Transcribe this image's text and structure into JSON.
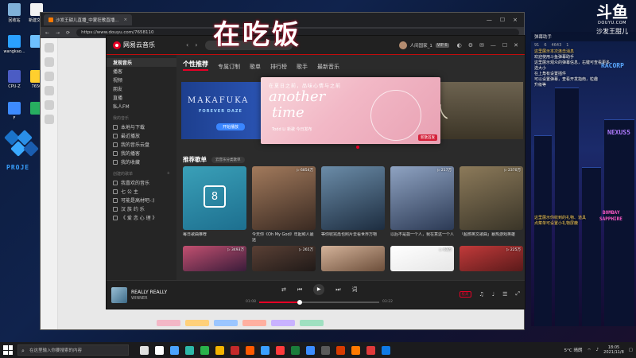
{
  "desktop": {
    "icons": [
      {
        "label": "回收站",
        "color": "#7fb1d9"
      },
      {
        "label": "新建文本",
        "color": "#f2f2f2"
      },
      {
        "label": "wangkao...",
        "color": "#2aa0ff"
      },
      {
        "label": "",
        "color": "#6ec0ff"
      },
      {
        "label": "CPU-Z",
        "color": "#4b5cc4"
      },
      {
        "label": "7656",
        "color": "#ffcf2e"
      },
      {
        "label": "F",
        "color": "#3d8bff"
      },
      {
        "label": "",
        "color": "#27ae60"
      }
    ],
    "deco_text": "PROJE"
  },
  "douyu": {
    "logo": "斗鱼",
    "url": "DOUYU.COM",
    "streamer": "沙发王甜儿"
  },
  "overlay": {
    "title": "在吃饭"
  },
  "browser": {
    "tab_title": "沙发王甜儿直播_中蒙狂歌直播...",
    "address": "https://www.douyu.com/7658110",
    "close": "×",
    "min": "—",
    "max": "☐",
    "back": "←",
    "fwd": "→",
    "refresh": "⟳"
  },
  "chat": {
    "header": "弹幕助手",
    "stats": [
      "91",
      "6",
      "4643",
      "1"
    ],
    "messages": [
      {
        "text": "这里展示本次连击消息",
        "sys": true
      },
      {
        "text": "欢迎使用斗鱼弹幕助手",
        "sys": false
      },
      {
        "text": "这里展示观众的弹幕信息，右键可查看更多",
        "sys": false
      },
      {
        "text": "选大小",
        "sys": false
      },
      {
        "text": "在上角有设置插件",
        "sys": false
      },
      {
        "text": "可以设置弹幕，查看开发指南，粒趣",
        "sys": false
      },
      {
        "text": "升级等",
        "sys": false
      },
      {
        "text": "这里展示你收到的礼物、道具",
        "sys": true
      },
      {
        "text": "点菜单可设置小礼物屏蔽",
        "sys": true
      }
    ],
    "neon": [
      "RACORP",
      "NEXUS5",
      "BOMBAY",
      "SAPPHIRE"
    ]
  },
  "ncm": {
    "app_name": "网易云音乐",
    "search_placeholder": "",
    "user_name": "人间国家_1",
    "vip": "VIP 6",
    "sidebar": {
      "items_top": [
        "发现音乐",
        "播客",
        "视频",
        "朋友",
        "直播",
        "私人FM"
      ],
      "section_mine": "我的音乐",
      "items_mine": [
        "本地与下载",
        "最近播放",
        "我的音乐云盘",
        "我的播客",
        "我的收藏"
      ],
      "section_created": "创建的歌单",
      "items_created": [
        "我喜欢的音乐",
        "七 公 主",
        "可能是高材吧-:)",
        "汉 族 约 乐",
        "《 爱 恋 心 理 》"
      ]
    },
    "tabs": [
      "个性推荐",
      "专属订制",
      "歌单",
      "排行榜",
      "歌手",
      "最新音乐"
    ],
    "banner": {
      "left_title": "MAKAFUKA",
      "left_sub": "FOREVER DAZE",
      "left_btn": "开始播放",
      "center_zh": "在夏日之前，品味心情与之前",
      "center_en1": "another",
      "center_en2": "time",
      "center_artist": "Todd Li 新歌 今日发布",
      "center_tag": "新歌首发",
      "right_char": "人"
    },
    "recommend": {
      "title": "推荐歌单",
      "pill": "云音乐分类歌单",
      "cards": [
        {
          "title": "每日歌曲推荐",
          "plays": "",
          "c1": "#1d6f8f",
          "c2": "#3aa0b8",
          "calendar": "8"
        },
        {
          "title": "今天你《Oh My God》年起和人最远",
          "plays": "▷ 6854万",
          "c1": "#3a2a22",
          "c2": "#a27a5c"
        },
        {
          "title": "等你收完再也照片去看世界万物",
          "plays": "",
          "c1": "#1d2d40",
          "c2": "#6b8ca8"
        },
        {
          "title": "以后不是孤一个人，我在意这一个人",
          "plays": "▷ 217万",
          "c1": "#2c3a55",
          "c2": "#8fa3c2"
        },
        {
          "title": "「超燃英文歌曲」暴热游戏英雄",
          "plays": "▷ 2370万",
          "c1": "#3a3528",
          "c2": "#8c7a5a"
        }
      ],
      "cards_row2": [
        {
          "plays": "▷ 3493万",
          "c1": "#3a1c3a",
          "c2": "#c25070"
        },
        {
          "plays": "▷ 265万",
          "c1": "#201a18",
          "c2": "#5a4035"
        },
        {
          "plays": "",
          "c1": "#6c4e3a",
          "c2": "#d4b39a"
        },
        {
          "plays": "▷ 63万",
          "c1": "#e6e6e6",
          "c2": "#ffffff"
        },
        {
          "plays": "▷ 225万",
          "c1": "#5a1a1a",
          "c2": "#c23a3a"
        }
      ]
    },
    "player": {
      "song": "REALLY REALLY",
      "singer": "WINNER",
      "time_cur": "01:08",
      "time_total": "03:22",
      "progress": 0.34,
      "quality": "极高",
      "controls": [
        "⇄",
        "⏮",
        "▶",
        "⏭",
        "词"
      ],
      "right_icons": [
        "♫",
        "♩",
        "☰",
        "⤢"
      ]
    }
  },
  "taskbar": {
    "search_placeholder": "在这里输入你要搜索的内容",
    "apps": [
      "#e0e0e0",
      "#ffffff",
      "#4aa3ff",
      "#2db8a8",
      "#2ab24a",
      "#f4b400",
      "#c32a2a",
      "#ff5a00",
      "#3aa0ff",
      "#ff3b3b",
      "#1b7d3a",
      "#3c8dff",
      "#5a5a5a",
      "#d83b01",
      "#ff7a00",
      "#e03a3a",
      "#0f7ae5"
    ],
    "weather": "5°C 晴朗",
    "time": "18:05",
    "date": "2021/11/8"
  }
}
